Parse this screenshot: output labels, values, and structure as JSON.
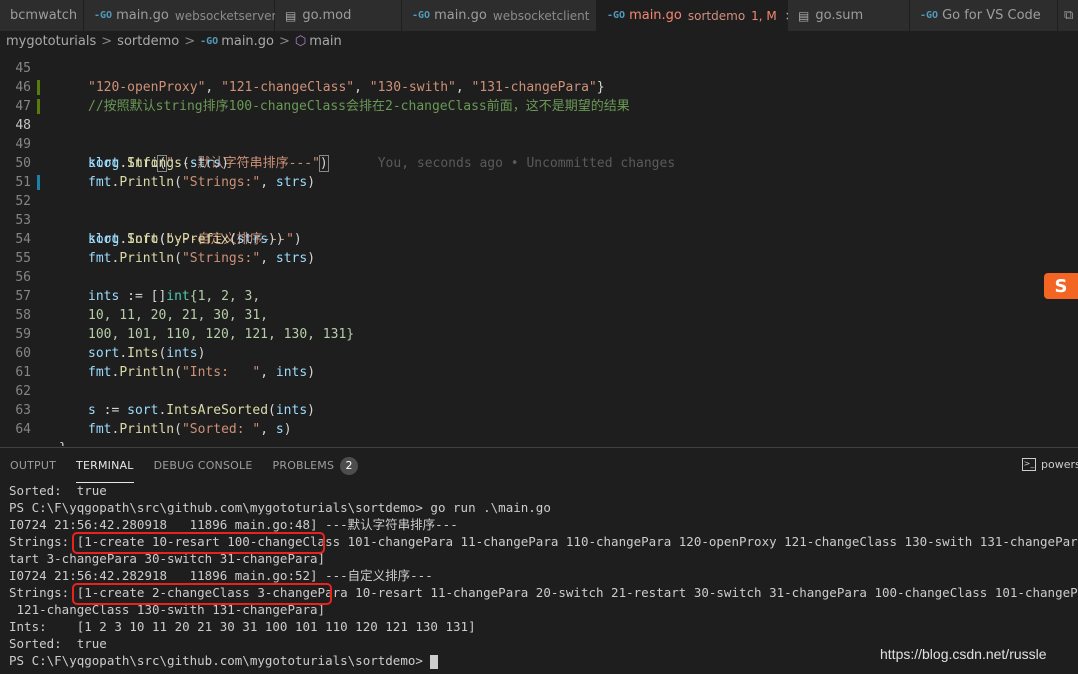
{
  "tabs": [
    {
      "name": "bcmwatch",
      "desc": "",
      "badge": "",
      "icon": "file-icon"
    },
    {
      "name": "main.go",
      "desc": "websocketserver",
      "badge": "",
      "icon": "go-file-icon"
    },
    {
      "name": "go.mod",
      "desc": "",
      "badge": "",
      "icon": "file-icon"
    },
    {
      "name": "main.go",
      "desc": "websocketclient",
      "badge": "",
      "icon": "go-file-icon"
    },
    {
      "name": "main.go",
      "desc": "sortdemo",
      "badge": "1, M",
      "icon": "go-file-icon",
      "close": "×"
    },
    {
      "name": "go.sum",
      "desc": "",
      "badge": "",
      "icon": "file-icon"
    },
    {
      "name": "Go for VS Code",
      "desc": "",
      "badge": "",
      "icon": "go-logo-icon"
    }
  ],
  "go_icon_text": "-GO",
  "breadcrumb": {
    "folder1": "mygototurials",
    "folder2": "sortdemo",
    "file": "main.go",
    "symbol": "main",
    "sep": ">"
  },
  "editor": {
    "line_numbers": [
      "45",
      "46",
      "47",
      "48",
      "49",
      "50",
      "51",
      "52",
      "53",
      "54",
      "55",
      "56",
      "57",
      "58",
      "59",
      "60",
      "61",
      "62",
      "63",
      "64"
    ],
    "lines": {
      "l45a": "\"120-openProxy\"",
      "l45b": ", ",
      "l45c": "\"121-changeClass\"",
      "l45d": ", ",
      "l45e": "\"130-swith\"",
      "l45f": ", ",
      "l45g": "\"131-changePara\"",
      "l45h": "}",
      "l46": "//按照默认string排序100-changeClass会排在2-changeClass前面，这不是期望的结果",
      "l48_pkg": "klog",
      "l48_fn": "Info",
      "l48_str": "\"---默认字符串排序---\"",
      "l48_blame": "You, seconds ago • Uncommitted changes",
      "l49_pkg": "sort",
      "l49_fn": "Strings",
      "l49_arg": "strs",
      "l50_pkg": "fmt",
      "l50_fn": "Println",
      "l50_str": "\"Strings:\"",
      "l50_arg": "strs",
      "l52_pkg": "klog",
      "l52_fn": "Info",
      "l52_str": "\"---自定义排序---\"",
      "l53_pkg": "sort",
      "l53_fn": "Sort",
      "l53_fn2": "byPrefix",
      "l53_arg": "strs",
      "l54_pkg": "fmt",
      "l54_fn": "Println",
      "l54_str": "\"Strings:\"",
      "l54_arg": "strs",
      "l56_var": "ints",
      "l56_op": " := []",
      "l56_type": "int",
      "l56_rest": "{1, 2, 3,",
      "l57": "10, 11, 20, 21, 30, 31,",
      "l58": "100, 101, 110, 120, 121, 130, 131}",
      "l59_pkg": "sort",
      "l59_fn": "Ints",
      "l59_arg": "ints",
      "l60_pkg": "fmt",
      "l60_fn": "Println",
      "l60_str": "\"Ints:   \"",
      "l60_arg": "ints",
      "l62_var": "s",
      "l62_op": " := ",
      "l62_pkg": "sort",
      "l62_fn": "IntsAreSorted",
      "l62_arg": "ints",
      "l63_pkg": "fmt",
      "l63_fn": "Println",
      "l63_str": "\"Sorted: \"",
      "l63_arg": "s",
      "l64": "}"
    }
  },
  "sougou_logo": "S",
  "panel": {
    "tabs": [
      "OUTPUT",
      "TERMINAL",
      "DEBUG CONSOLE",
      "PROBLEMS"
    ],
    "problems_count": "2",
    "terminal_select": "powers"
  },
  "terminal": {
    "lines": [
      "Sorted:  true",
      "PS C:\\F\\yqgopath\\src\\github.com\\mygototurials\\sortdemo> go run .\\main.go",
      "I0724 21:56:42.280918   11896 main.go:48] ---默认字符串排序---",
      "Strings: [1-create 10-resart 100-changeClass 101-changePara 11-changePara 110-changePara 120-openProxy 121-changeClass 130-swith 131-changePara 2-changeC",
      "tart 3-changePara 30-switch 31-changePara]",
      "I0724 21:56:42.282918   11896 main.go:52] ---自定义排序---",
      "Strings: [1-create 2-changeClass 3-changePara 10-resart 11-changePara 20-switch 21-restart 30-switch 31-changePara 100-changeClass 101-changePara 110-cha",
      " 121-changeClass 130-swith 131-changePara]",
      "Ints:    [1 2 3 10 11 20 21 30 31 100 101 110 120 121 130 131]",
      "Sorted:  true",
      "PS C:\\F\\yqgopath\\src\\github.com\\mygototurials\\sortdemo> "
    ]
  },
  "watermark": "https://blog.csdn.net/russle",
  "colors": {
    "accent_error": "#f48771",
    "highlight_box": "#e8231d"
  }
}
